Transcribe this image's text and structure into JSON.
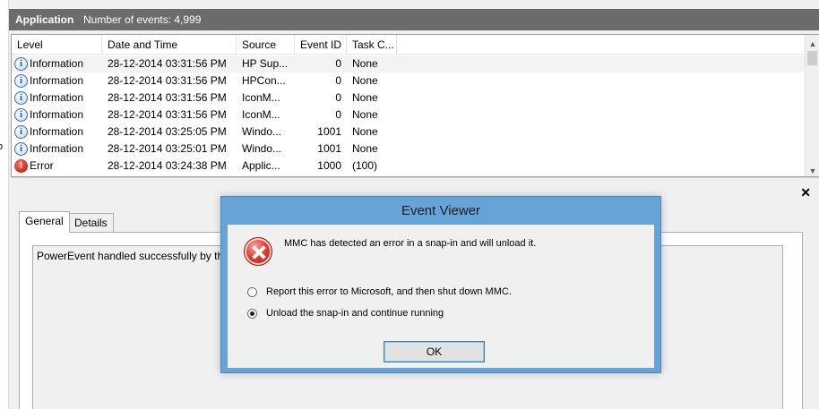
{
  "left_fragment": "o",
  "header": {
    "title": "Application",
    "event_count": "Number of events: 4,999"
  },
  "columns": {
    "level": "Level",
    "date": "Date and Time",
    "source": "Source",
    "event_id": "Event ID",
    "task": "Task C..."
  },
  "events": [
    {
      "level": "Information",
      "icon": "info-icon",
      "date": "28-12-2014 03:31:56 PM",
      "source": "HP Sup...",
      "event_id": "0",
      "task": "None"
    },
    {
      "level": "Information",
      "icon": "info-icon",
      "date": "28-12-2014 03:31:56 PM",
      "source": "HPCon...",
      "event_id": "0",
      "task": "None"
    },
    {
      "level": "Information",
      "icon": "info-icon",
      "date": "28-12-2014 03:31:56 PM",
      "source": "IconM...",
      "event_id": "0",
      "task": "None"
    },
    {
      "level": "Information",
      "icon": "info-icon",
      "date": "28-12-2014 03:31:56 PM",
      "source": "IconM...",
      "event_id": "0",
      "task": "None"
    },
    {
      "level": "Information",
      "icon": "info-icon",
      "date": "28-12-2014 03:25:05 PM",
      "source": "Windo...",
      "event_id": "1001",
      "task": "None"
    },
    {
      "level": "Information",
      "icon": "info-icon",
      "date": "28-12-2014 03:25:01 PM",
      "source": "Windo...",
      "event_id": "1001",
      "task": "None"
    },
    {
      "level": "Error",
      "icon": "error-icon",
      "date": "28-12-2014 03:24:38 PM",
      "source": "Applic...",
      "event_id": "1000",
      "task": "(100)"
    }
  ],
  "details": {
    "tabs": {
      "general": "General",
      "details": "Details"
    },
    "description": "PowerEvent handled successfully by the"
  },
  "dialog": {
    "title": "Event Viewer",
    "message": "MMC has detected an error in a snap-in and will unload it.",
    "option_report": "Report this error to Microsoft, and then shut down MMC.",
    "option_unload": "Unload the snap-in and continue running",
    "ok_label": "OK"
  },
  "colors": {
    "dialog_frame": "#66a3d6",
    "header_bar": "#6b6b6b",
    "error_red": "#c8281a",
    "info_blue": "#1f56a8"
  }
}
